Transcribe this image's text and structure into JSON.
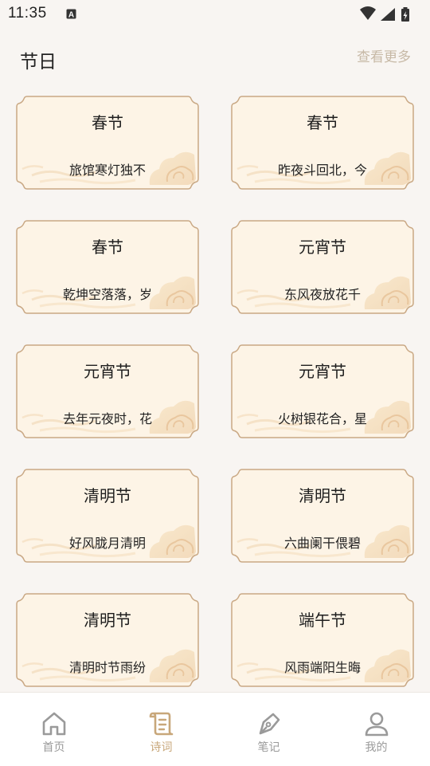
{
  "status_bar": {
    "time": "11:35",
    "icons": [
      "text-input-icon",
      "wifi-icon",
      "signal-icon",
      "battery-charging-icon"
    ]
  },
  "header": {
    "title": "节日",
    "more_label": "查看更多"
  },
  "cards": [
    {
      "title": "春节",
      "line": "旅馆寒灯独不"
    },
    {
      "title": "春节",
      "line": "昨夜斗回北，今"
    },
    {
      "title": "春节",
      "line": "乾坤空落落，岁"
    },
    {
      "title": "元宵节",
      "line": "东风夜放花千"
    },
    {
      "title": "元宵节",
      "line": "去年元夜时，花"
    },
    {
      "title": "元宵节",
      "line": "火树银花合，星"
    },
    {
      "title": "清明节",
      "line": "好风胧月清明"
    },
    {
      "title": "清明节",
      "line": "六曲阑干偎碧"
    },
    {
      "title": "清明节",
      "line": "清明时节雨纷"
    },
    {
      "title": "端午节",
      "line": "风雨端阳生晦"
    }
  ],
  "tabbar": {
    "tabs": [
      {
        "label": "首页",
        "icon": "home-icon",
        "active": false
      },
      {
        "label": "诗词",
        "icon": "scroll-icon",
        "active": true
      },
      {
        "label": "笔记",
        "icon": "pen-nib-icon",
        "active": false
      },
      {
        "label": "我的",
        "icon": "user-icon",
        "active": false
      }
    ]
  },
  "colors": {
    "background": "#f8f5f2",
    "card_fill": "#fdf4e6",
    "card_border": "#c9a884",
    "accent": "#c8a77a",
    "more_link": "#c7b9a6",
    "inactive_tab": "#9a9a9a"
  }
}
